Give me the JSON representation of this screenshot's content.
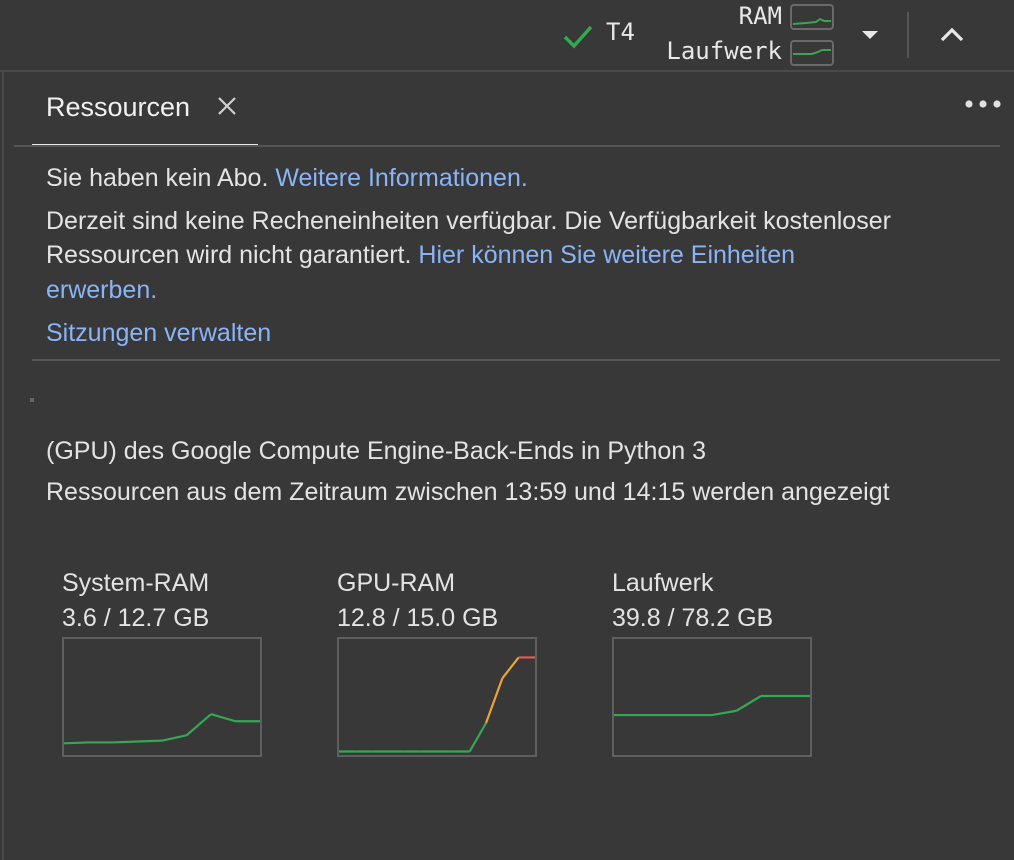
{
  "header": {
    "runtime_label": "T4",
    "ram_label": "RAM",
    "disk_label": "Laufwerk",
    "colors": {
      "ok": "#34a853",
      "spark": "#34a853"
    }
  },
  "panel": {
    "tab_label": "Ressourcen",
    "subscription_text": "Sie haben kein Abo.",
    "subscription_link": "Weitere Informationen.",
    "units_line1": "Derzeit sind keine Recheneinheiten verfügbar. Die Verfügbarkeit kostenloser",
    "units_line2": "Ressourcen wird nicht garantiert.",
    "units_link_part1": "Hier können Sie weitere Einheiten",
    "units_link_part2": "erwerben.",
    "manage_sessions": "Sitzungen verwalten",
    "backend_info": "(GPU) des Google Compute Engine-Back-Ends in Python 3",
    "time_range": "Ressourcen aus dem Zeitraum zwischen 13:59 und 14:15 werden angezeigt"
  },
  "metrics": [
    {
      "title": "System-RAM",
      "value": "3.6 / 12.7 GB"
    },
    {
      "title": "GPU-RAM",
      "value": "12.8 / 15.0 GB"
    },
    {
      "title": "Laufwerk",
      "value": "39.8 / 78.2 GB"
    }
  ],
  "chart_data": [
    {
      "type": "line",
      "title": "System-RAM",
      "ylim": [
        0,
        12.7
      ],
      "x": [
        0,
        1,
        2,
        3,
        4,
        5,
        6,
        7,
        8
      ],
      "values": [
        1.1,
        1.2,
        1.2,
        1.3,
        1.4,
        2.0,
        4.4,
        3.6,
        3.6
      ],
      "colors": [
        "#34a853"
      ]
    },
    {
      "type": "line",
      "title": "GPU-RAM",
      "ylim": [
        0,
        15.0
      ],
      "x": [
        0,
        1,
        2,
        3,
        4,
        5,
        6,
        7,
        8,
        9,
        10,
        11,
        12
      ],
      "values": [
        0.2,
        0.2,
        0.2,
        0.2,
        0.2,
        0.2,
        0.2,
        0.2,
        0.2,
        4.0,
        10.0,
        12.8,
        12.8
      ],
      "colors": [
        "#34a853",
        "#e8a33d",
        "#e06050"
      ]
    },
    {
      "type": "line",
      "title": "Laufwerk",
      "ylim": [
        0,
        78.2
      ],
      "x": [
        0,
        1,
        2,
        3,
        4,
        5,
        6,
        7,
        8
      ],
      "values": [
        26.5,
        26.5,
        26.5,
        26.5,
        26.5,
        29.5,
        39.8,
        39.8,
        39.8
      ],
      "colors": [
        "#34a853"
      ]
    }
  ]
}
